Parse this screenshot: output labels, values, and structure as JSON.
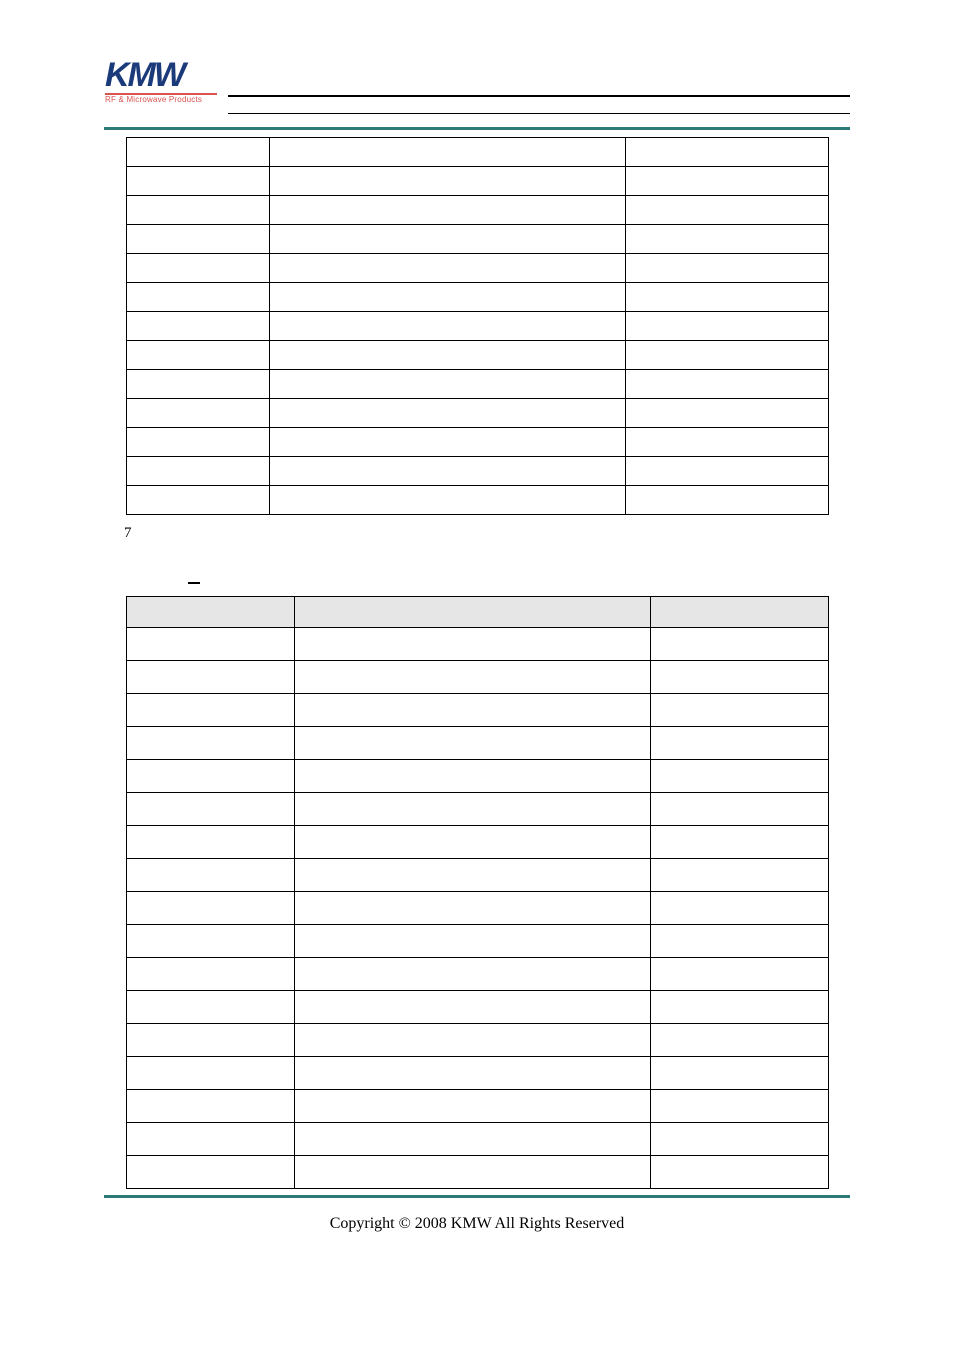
{
  "logo": {
    "main": "KMW",
    "sub": "RF & Microwave Products"
  },
  "table1_rows": [
    [
      "",
      "",
      ""
    ],
    [
      "",
      "",
      ""
    ],
    [
      "",
      "",
      ""
    ],
    [
      "",
      "",
      ""
    ],
    [
      "",
      "",
      ""
    ],
    [
      "",
      "",
      ""
    ],
    [
      "",
      "",
      ""
    ],
    [
      "",
      "",
      ""
    ],
    [
      "",
      "",
      ""
    ],
    [
      "",
      "",
      ""
    ],
    [
      "",
      "",
      ""
    ],
    [
      "",
      "",
      ""
    ],
    [
      "",
      "",
      ""
    ]
  ],
  "page_number": "7",
  "table2_header": [
    "",
    "",
    ""
  ],
  "table2_rows": [
    [
      "",
      "",
      ""
    ],
    [
      "",
      "",
      ""
    ],
    [
      "",
      "",
      ""
    ],
    [
      "",
      "",
      ""
    ],
    [
      "",
      "",
      ""
    ],
    [
      "",
      "",
      ""
    ],
    [
      "",
      "",
      ""
    ],
    [
      "",
      "",
      ""
    ],
    [
      "",
      "",
      ""
    ],
    [
      "",
      "",
      ""
    ],
    [
      "",
      "",
      ""
    ],
    [
      "",
      "",
      ""
    ],
    [
      "",
      "",
      ""
    ],
    [
      "",
      "",
      ""
    ],
    [
      "",
      "",
      ""
    ],
    [
      "",
      "",
      ""
    ],
    [
      "",
      "",
      ""
    ]
  ],
  "footer": "Copyright © 2008 KMW All Rights Reserved"
}
